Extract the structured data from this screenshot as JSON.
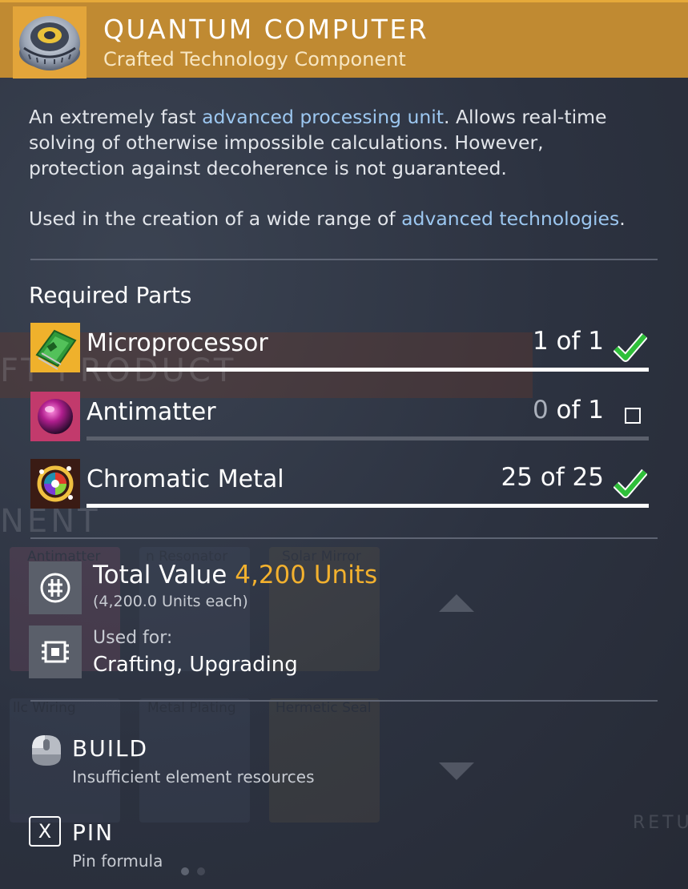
{
  "header": {
    "title": "QUANTUM COMPUTER",
    "subtitle": "Crafted Technology Component",
    "icon": "quantum-computer-icon",
    "accent_color": "#c08a32"
  },
  "description": {
    "para1_pre": "An extremely fast ",
    "para1_link": "advanced processing unit",
    "para1_post": ". Allows real-time solving of otherwise impossible calculations. However, protection against decoherence is not guaranteed.",
    "para2_pre": "Used in the creation of a wide range of ",
    "para2_link": "advanced technologies",
    "para2_post": ".",
    "highlight_color": "#9cc7f0"
  },
  "required_parts": {
    "title": "Required Parts",
    "items": [
      {
        "name": "Microprocessor",
        "have": "1",
        "of_label": " of ",
        "need": "1",
        "complete": true,
        "icon": "microprocessor-icon",
        "progress": 1.0
      },
      {
        "name": "Antimatter",
        "have": "0",
        "of_label": " of ",
        "need": "1",
        "complete": false,
        "icon": "antimatter-icon",
        "progress": 0.0
      },
      {
        "name": "Chromatic Metal",
        "have": "25",
        "of_label": " of ",
        "need": "25",
        "complete": true,
        "icon": "chromatic-metal-icon",
        "progress": 1.0
      }
    ]
  },
  "value": {
    "label": "Total Value ",
    "amount": "4,200 Units",
    "each": "(4,200.0 Units each)",
    "icon": "units-icon",
    "amount_color": "#f3b12e"
  },
  "usage": {
    "label": "Used for:",
    "value": "Crafting, Upgrading",
    "icon": "chip-icon"
  },
  "actions": {
    "build": {
      "title": "BUILD",
      "desc": "Insufficient element resources",
      "icon": "mouse-icon"
    },
    "pin": {
      "title": "PIN",
      "desc": "Pin formula",
      "key": "X"
    }
  },
  "background": {
    "tiles": [
      "Antimatter",
      "n Resonator",
      "Solar Mirror",
      "llc Wiring",
      "Metal Plating",
      "Hermetic Seal"
    ],
    "words": [
      "FT PRODUCT",
      "NENT",
      "RETU"
    ]
  }
}
